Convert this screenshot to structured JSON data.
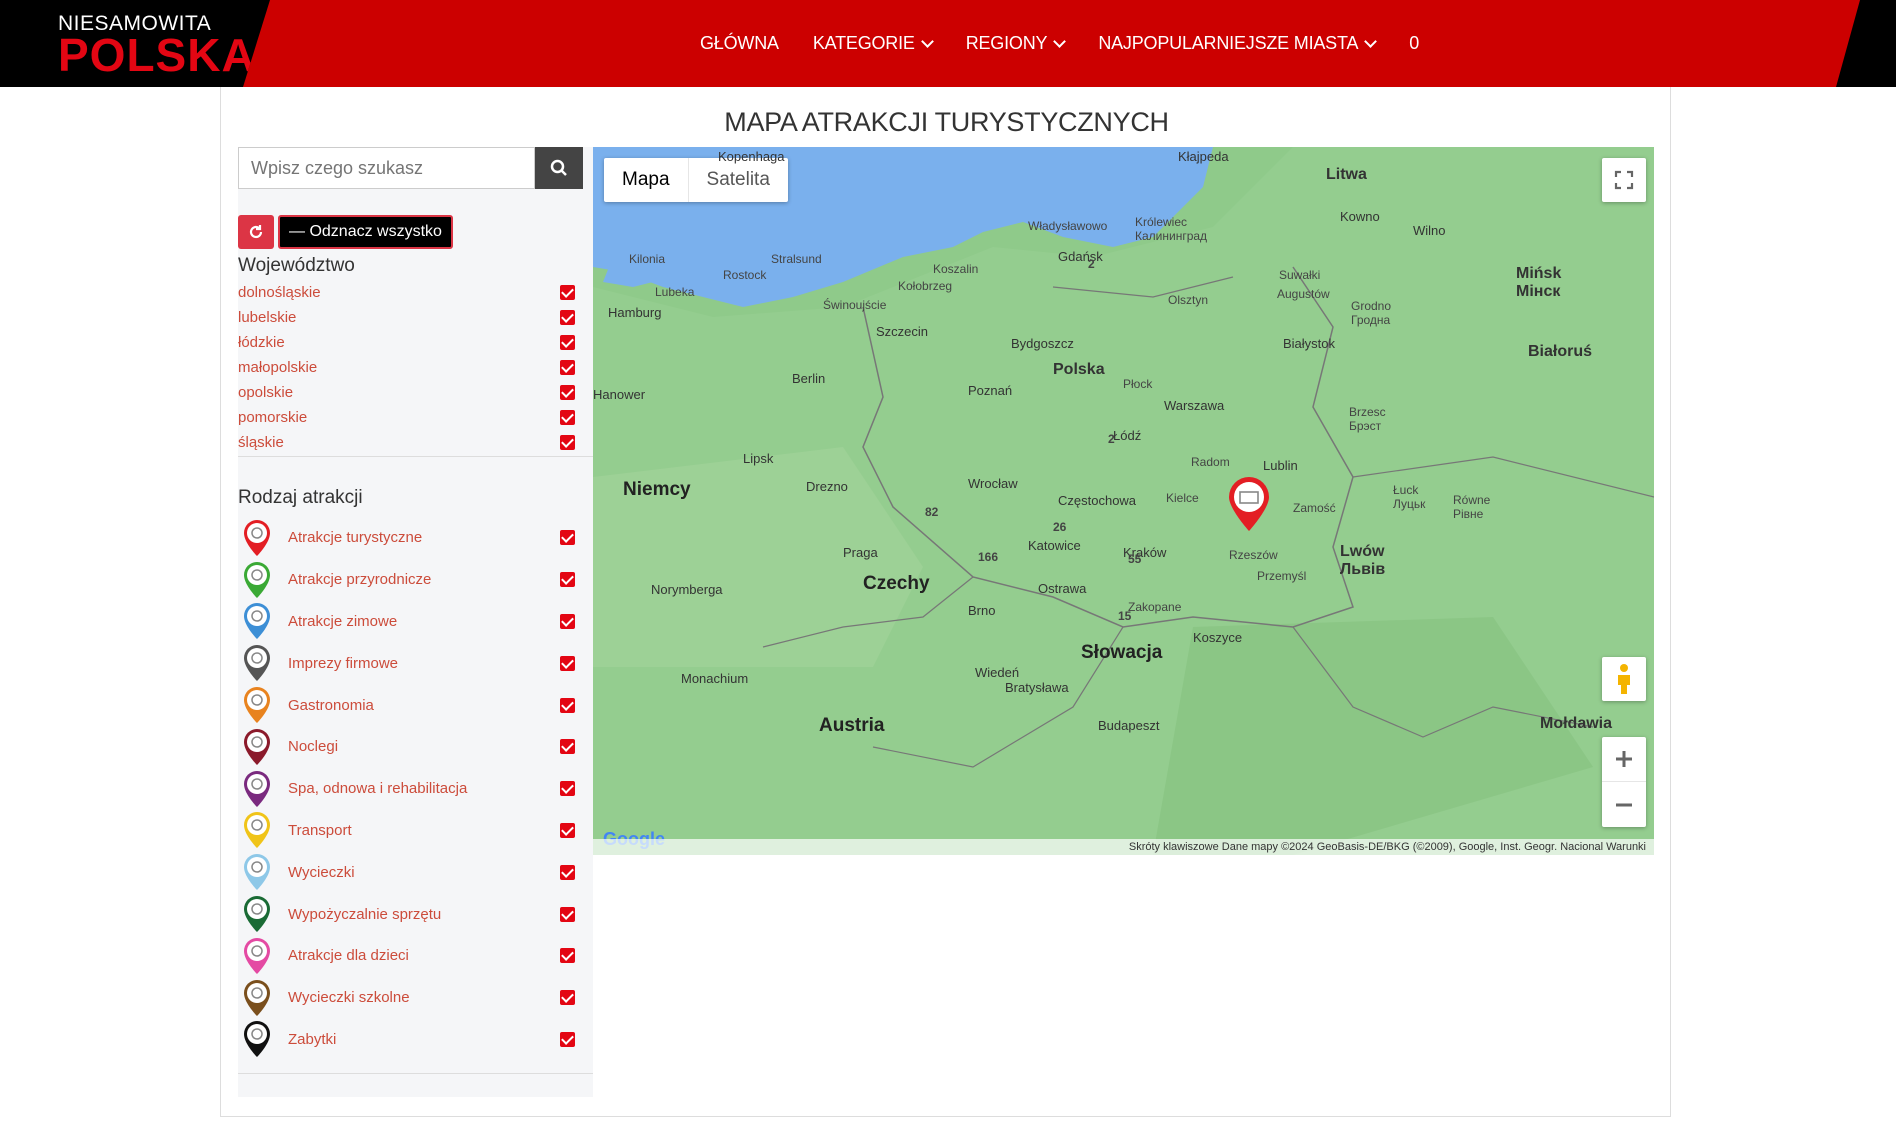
{
  "header": {
    "logo_top": "NIESAMOWITA",
    "logo_bottom": "POLSKA",
    "nav": [
      "GŁÓWNA",
      "KATEGORIE",
      "REGIONY",
      "NAJPOPULARNIEJSZE MIASTA",
      "0"
    ]
  },
  "page": {
    "title": "MAPA ATRAKCJI TURYSTYCZNYCH"
  },
  "sidebar": {
    "search_placeholder": "Wpisz czego szukasz",
    "uncheck_label": "— Odznacz wszystko",
    "woj_title": "Województwo",
    "woj_items": [
      "dolnośląskie",
      "lubelskie",
      "łódzkie",
      "małopolskie",
      "opolskie",
      "pomorskie",
      "śląskie"
    ],
    "attr_title": "Rodzaj atrakcji",
    "attr_items": [
      {
        "label": "Atrakcje turystyczne",
        "color": "#e31e24"
      },
      {
        "label": "Atrakcje przyrodnicze",
        "color": "#3aa935"
      },
      {
        "label": "Atrakcje zimowe",
        "color": "#3d8fd6"
      },
      {
        "label": "Imprezy firmowe",
        "color": "#555555"
      },
      {
        "label": "Gastronomia",
        "color": "#e8831f"
      },
      {
        "label": "Noclegi",
        "color": "#8b1a2b"
      },
      {
        "label": "Spa, odnowa i rehabilitacja",
        "color": "#7a2a7f"
      },
      {
        "label": "Transport",
        "color": "#f0c419"
      },
      {
        "label": "Wycieczki",
        "color": "#8ec8e8"
      },
      {
        "label": "Wypożyczalnie sprzętu",
        "color": "#1a6b35"
      },
      {
        "label": "Atrakcje dla dzieci",
        "color": "#e44aa3"
      },
      {
        "label": "Wycieczki szkolne",
        "color": "#7a4f1d"
      },
      {
        "label": "Zabytki",
        "color": "#111111"
      }
    ]
  },
  "map": {
    "tab_map": "Mapa",
    "tab_sat": "Satelita",
    "labels": {
      "kopenhaga": "Kopenhaga",
      "klajpeda": "Kłajpeda",
      "litwa": "Litwa",
      "kowno": "Kowno",
      "wilno": "Wilno",
      "mińsk": "Mińsk\nМінск",
      "gdansk": "Gdańsk",
      "krolewiec": "Królewiec\nКалининград",
      "wladyslawowo": "Władysławowo",
      "koszalin": "Koszalin",
      "kolobrzeg": "Kołobrzeg",
      "rostock": "Rostock",
      "stralsund": "Stralsund",
      "kilonia": "Kilonia",
      "lubeka": "Lubeka",
      "hamburg": "Hamburg",
      "swinoujscie": "Świnoujście",
      "szczecin": "Szczecin",
      "olsztyn": "Olsztyn",
      "suwalki": "Suwałki",
      "augustow": "Augustów",
      "grodno": "Grodno\nГродна",
      "bydgoszcz": "Bydgoszcz",
      "polska": "Polska",
      "bialystok": "Białystok",
      "bialorus": "Białoruś",
      "berlin": "Berlin",
      "poznan": "Poznań",
      "plock": "Płock",
      "warszawa": "Warszawa",
      "hanower": "Hanower",
      "lodz": "Łódź",
      "radom": "Radom",
      "lublin": "Lublin",
      "brzesc": "Brzesc\nБрэст",
      "lipsk": "Lipsk",
      "wroclaw": "Wrocław",
      "drezno": "Drezno",
      "niemcy": "Niemcy",
      "czestochowa": "Częstochowa",
      "kielce": "Kielce",
      "zamosc": "Zamość",
      "luck": "Łuck\nЛуцьк",
      "rowne": "Równe\nРівне",
      "katowice": "Katowice",
      "krakow": "Kraków",
      "rzeszow": "Rzeszów",
      "lwow": "Lwów\nЛьвів",
      "praga": "Praga",
      "czechy": "Czechy",
      "ostrawa": "Ostrawa",
      "przemysl": "Przemyśl",
      "norymberga": "Norymberga",
      "brno": "Brno",
      "zakopane": "Zakopane",
      "slowacja": "Słowacja",
      "koszyce": "Koszyce",
      "monachium": "Monachium",
      "wieden": "Wiedeń",
      "bratyslawa": "Bratysława",
      "austria": "Austria",
      "budapeszt": "Budapeszt",
      "moldawia": "Mołdawia"
    },
    "cluster_counts": [
      "2",
      "2",
      "82",
      "26",
      "166",
      "55",
      "15"
    ],
    "attribution": "Skróty klawiszowe   Dane mapy ©2024 GeoBasis-DE/BKG (©2009), Google, Inst. Geogr. Nacional   Warunki"
  }
}
